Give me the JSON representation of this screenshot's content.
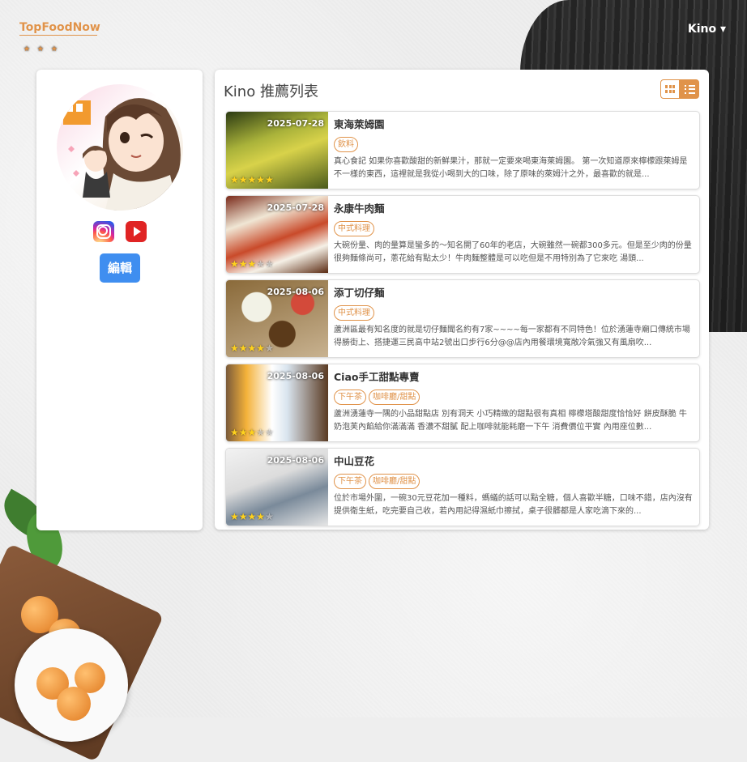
{
  "header": {
    "logo_stars_top": "★ ★ ★",
    "logo_text": "TopFoodNow",
    "logo_stars_bottom": "★ ★ ★",
    "user_name": "Kino",
    "user_caret": "▾"
  },
  "profile": {
    "edit_label": "編輯",
    "social": [
      "instagram-icon",
      "youtube-icon"
    ]
  },
  "list": {
    "title": "Kino 推薦列表",
    "items": [
      {
        "date": "2025-07-28",
        "name": "東海萊姆園",
        "tags": [
          "飲料"
        ],
        "rating": 5,
        "desc": "真心食記 如果你喜歡酸甜的新鮮果汁，那就一定要來喝東海萊姆園。 第一次知道原來檸檬跟萊姆是不一樣的東西，這裡就是我從小喝到大的口味，除了原味的萊姆汁之外，最喜歡的就是..."
      },
      {
        "date": "2025-07-28",
        "name": "永康牛肉麵",
        "tags": [
          "中式料理"
        ],
        "rating": 3,
        "desc": "大碗份量、肉的量算是蠻多的～知名開了60年的老店，大碗雖然一碗都300多元。但是至少肉的份量很夠麵條尚可，蔥花給有點太少！牛肉麵整體是可以吃但是不用特別為了它來吃 湯頭..."
      },
      {
        "date": "2025-08-06",
        "name": "添丁切仔麵",
        "tags": [
          "中式料理"
        ],
        "rating": 4,
        "desc": "蘆洲區最有知名度的就是切仔麵聞名約有7家~~~~每一家都有不同特色！位於湧蓮寺廟口傳統市場得勝街上、搭捷運三民高中站2號出口步行6分@@店內用餐環境寬敞冷氣強又有風扇吹..."
      },
      {
        "date": "2025-08-06",
        "name": "Ciao手工甜點專賣",
        "tags": [
          "下午茶",
          "咖啡廳/甜點"
        ],
        "rating": 3,
        "desc": "蘆洲湧蓮寺一隅的小品甜點店 別有洞天 小巧精緻的甜點很有真相 檸檬塔酸甜度恰恰好 餅皮酥脆 牛奶泡芙內餡給你滿滿滿 香濃不甜膩 配上咖啡就能耗磨一下午 消費價位平實 內用座位數..."
      },
      {
        "date": "2025-08-06",
        "name": "中山豆花",
        "tags": [
          "下午茶",
          "咖啡廳/甜點"
        ],
        "rating": 4,
        "desc": "位於市場外圍，一碗30元豆花加一種料，螞蟻的話可以點全糖，個人喜歡半糖，口味不錯，店內沒有提供衛生紙，吃完要自己收，若內用記得濕紙巾擦拭，桌子很髒都是人家吃滴下來的..."
      }
    ]
  },
  "colors": {
    "accent": "#e0934a",
    "edit_button": "#3f8ef0",
    "star": "#ffd21e"
  }
}
